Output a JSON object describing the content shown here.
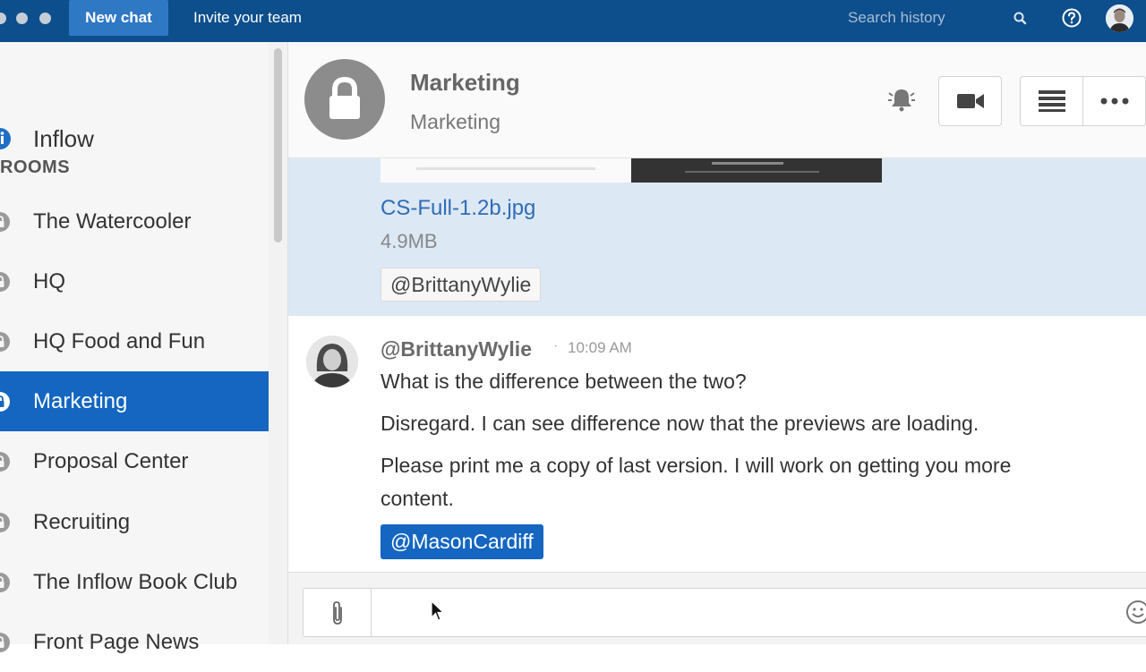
{
  "topbar": {
    "new_chat_label": "New chat",
    "invite_label": "Invite your team",
    "search_label": "Search history",
    "bg_color": "#0d4e8c"
  },
  "sidebar": {
    "app_name": "Inflow",
    "rooms_heading": "ROOMS",
    "items": [
      {
        "label": "The Watercooler"
      },
      {
        "label": "HQ"
      },
      {
        "label": "HQ Food and Fun"
      },
      {
        "label": "Marketing",
        "active": true
      },
      {
        "label": "Proposal Center"
      },
      {
        "label": "Recruiting"
      },
      {
        "label": "The Inflow Book Club"
      },
      {
        "label": "Front Page News"
      }
    ],
    "active_color": "#1466c0"
  },
  "header": {
    "title": "Marketing",
    "subtitle": "Marketing"
  },
  "messages": {
    "attachment": {
      "file_name": "CS-Full-1.2b.jpg",
      "file_size": "4.9MB",
      "mention": "@BrittanyWylie"
    },
    "message": {
      "author": "@BrittanyWylie",
      "separator": "·",
      "time": "10:09 AM",
      "lines": [
        "What is the difference between the two?",
        "Disregard. I can see difference now that the previews are loading.",
        "Please print me a copy of last version. I will work on getting you more content."
      ],
      "mention": "@MasonCardiff"
    }
  },
  "composer": {
    "placeholder": ""
  },
  "icons": [
    "search-icon",
    "help-icon",
    "avatar",
    "lock-icon",
    "bell-icon",
    "video-icon",
    "list-icon",
    "more-icon",
    "paperclip-icon",
    "emoji-icon"
  ]
}
